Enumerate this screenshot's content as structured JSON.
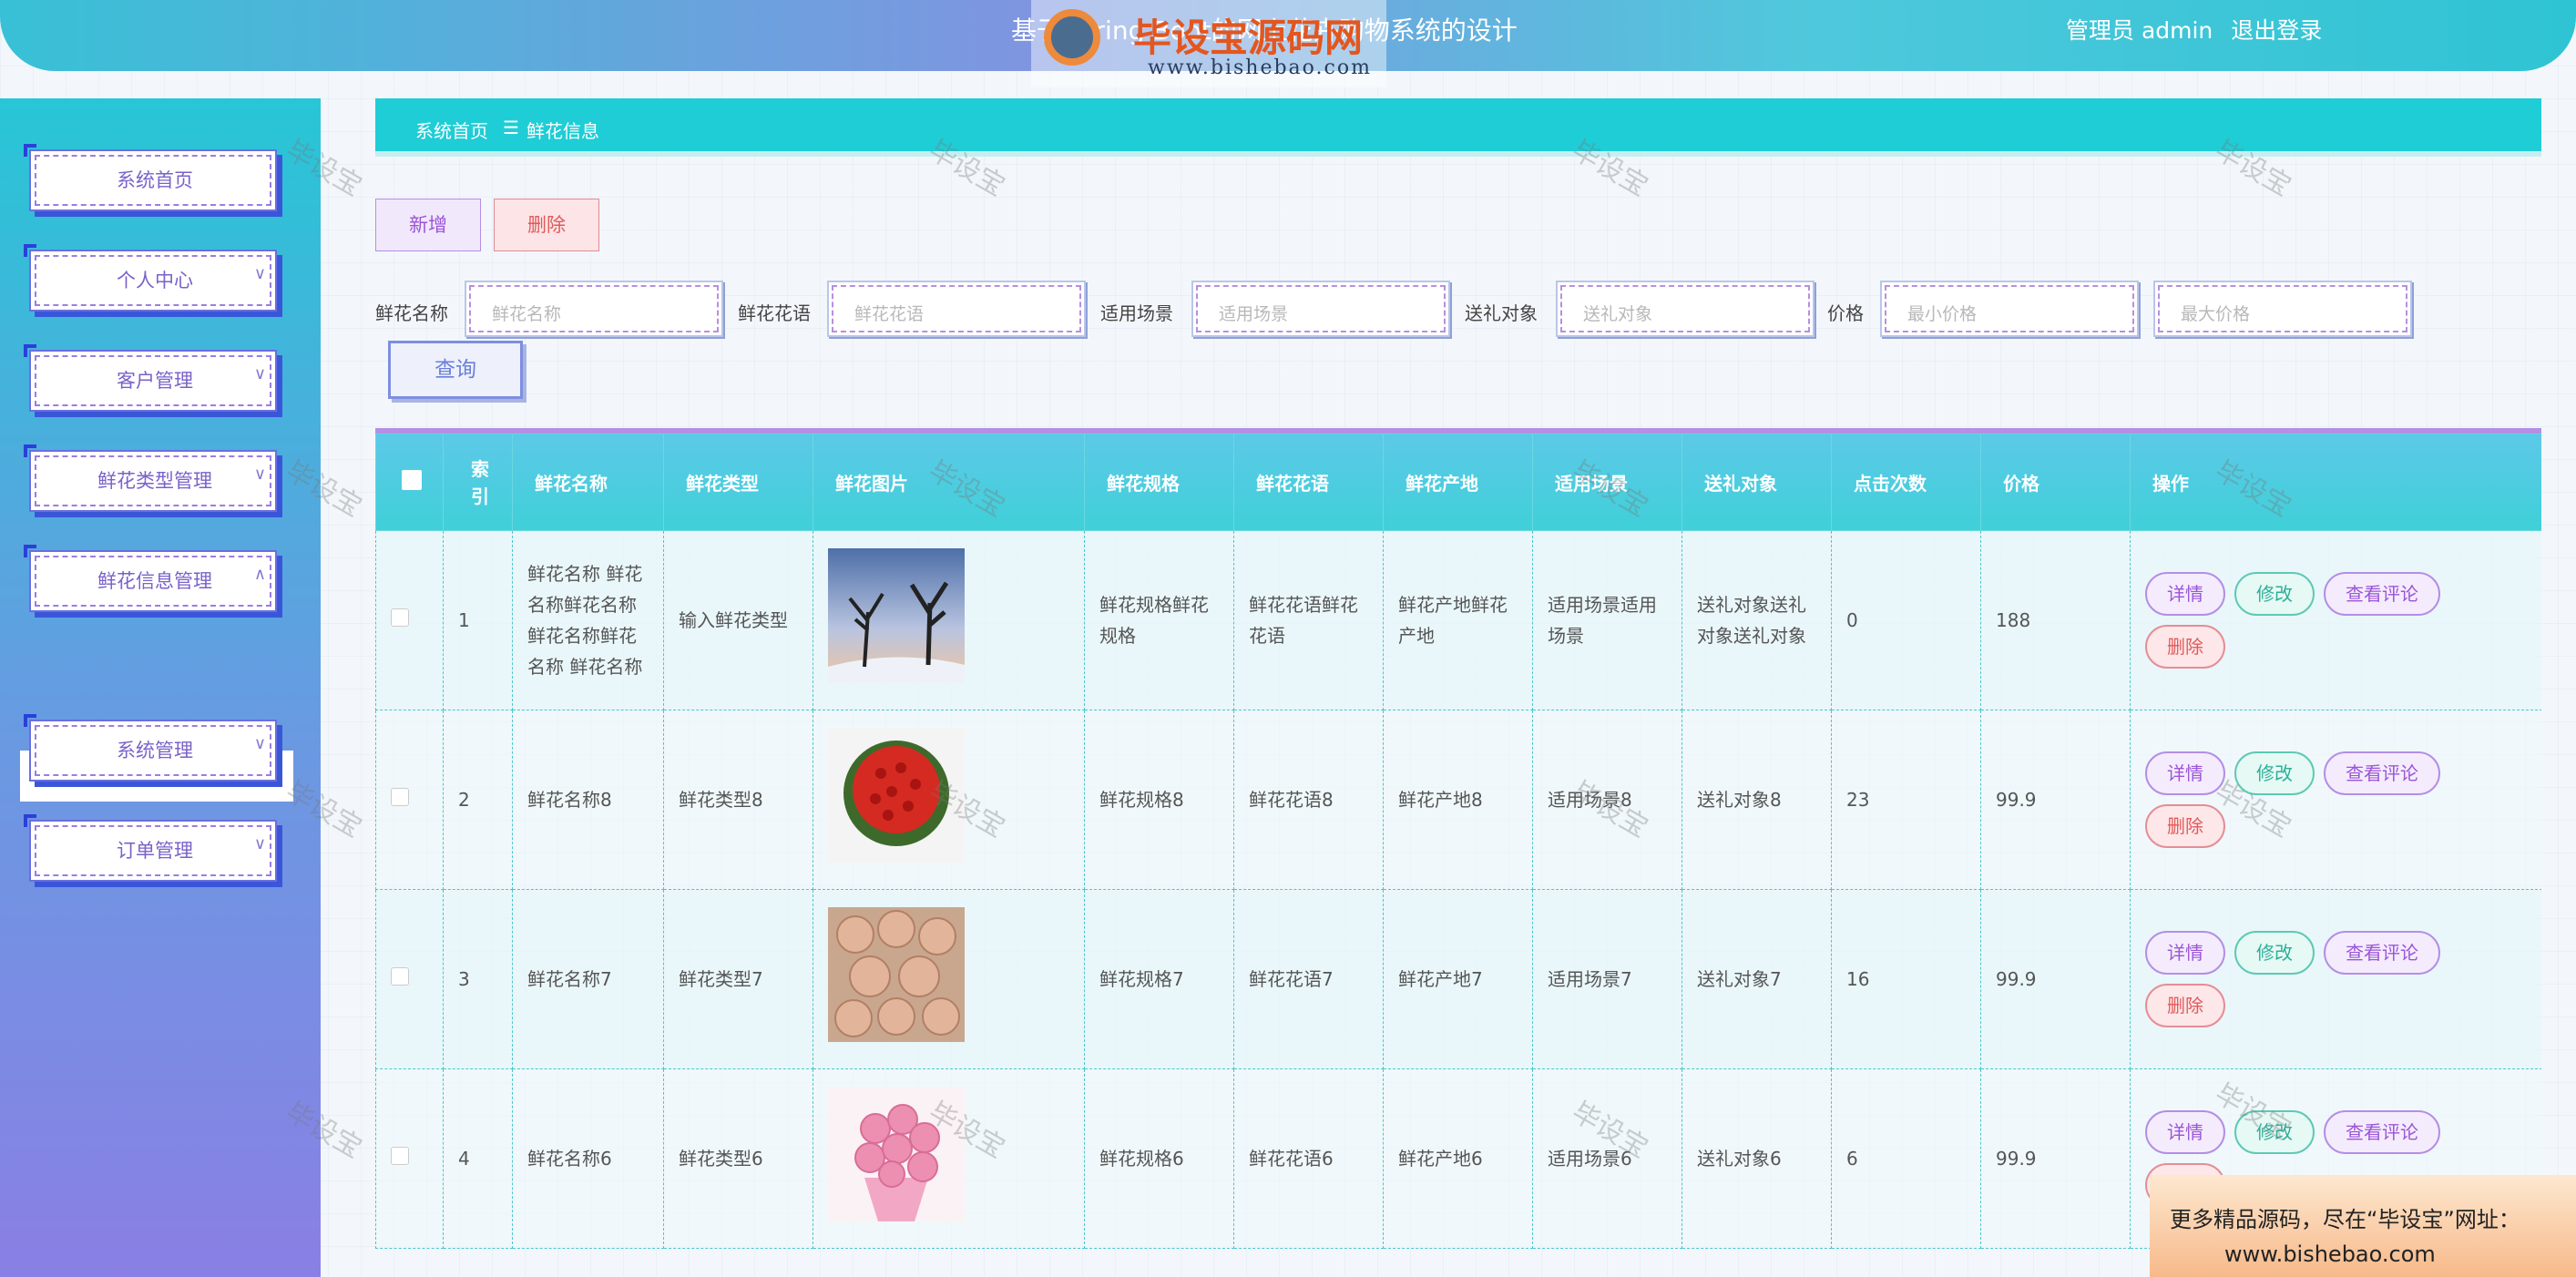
{
  "header": {
    "title": "基于Spring Boot的网上花卉购物系统的设计",
    "user_label": "管理员 admin",
    "logout_label": "退出登录",
    "logo_text": "毕设宝源码网",
    "logo_url": "www.bishebao.com"
  },
  "sidebar": {
    "items": [
      {
        "label": "系统首页"
      },
      {
        "label": "个人中心"
      },
      {
        "label": "客户管理"
      },
      {
        "label": "鲜花类型管理"
      },
      {
        "label": "鲜花信息管理"
      },
      {
        "label": "系统管理"
      },
      {
        "label": "订单管理"
      }
    ],
    "active_sub": "鲜花信息"
  },
  "breadcrumb": {
    "home": "系统首页",
    "separator": "☰",
    "current": "鲜花信息"
  },
  "toolbar": {
    "add_label": "新增",
    "delete_label": "删除"
  },
  "filters": {
    "name": {
      "label": "鲜花名称",
      "placeholder": "鲜花名称"
    },
    "language": {
      "label": "鲜花花语",
      "placeholder": "鲜花花语"
    },
    "scene": {
      "label": "适用场景",
      "placeholder": "适用场景"
    },
    "target": {
      "label": "送礼对象",
      "placeholder": "送礼对象"
    },
    "price": {
      "label": "价格",
      "min_placeholder": "最小价格",
      "max_placeholder": "最大价格"
    },
    "query_label": "查询"
  },
  "table": {
    "headers": [
      "索引",
      "鲜花名称",
      "鲜花类型",
      "鲜花图片",
      "鲜花规格",
      "鲜花花语",
      "鲜花产地",
      "适用场景",
      "送礼对象",
      "点击次数",
      "价格",
      "操作"
    ],
    "index_header": "索\n引",
    "rows": [
      {
        "index": "1",
        "name": "鲜花名称 鲜花名称鲜花名称鲜花名称鲜花名称 鲜花名称",
        "type": "输入鲜花类型",
        "spec": "鲜花规格鲜花规格",
        "language": "鲜花花语鲜花花语",
        "origin": "鲜花产地鲜花产地",
        "scene": "适用场景适用场景",
        "target": "送礼对象送礼对象送礼对象",
        "clicks": "0",
        "price": "188"
      },
      {
        "index": "2",
        "name": "鲜花名称8",
        "type": "鲜花类型8",
        "spec": "鲜花规格8",
        "language": "鲜花花语8",
        "origin": "鲜花产地8",
        "scene": "适用场景8",
        "target": "送礼对象8",
        "clicks": "23",
        "price": "99.9"
      },
      {
        "index": "3",
        "name": "鲜花名称7",
        "type": "鲜花类型7",
        "spec": "鲜花规格7",
        "language": "鲜花花语7",
        "origin": "鲜花产地7",
        "scene": "适用场景7",
        "target": "送礼对象7",
        "clicks": "16",
        "price": "99.9"
      },
      {
        "index": "4",
        "name": "鲜花名称6",
        "type": "鲜花类型6",
        "spec": "鲜花规格6",
        "language": "鲜花花语6",
        "origin": "鲜花产地6",
        "scene": "适用场景6",
        "target": "送礼对象6",
        "clicks": "6",
        "price": "99.9"
      }
    ],
    "actions": {
      "detail": "详情",
      "edit": "修改",
      "comments": "查看评论",
      "delete": "删除"
    }
  },
  "watermark": "毕设宝",
  "banner": {
    "line1": "更多精品源码，尽在“毕设宝”网址：",
    "line2": "www.bishebao.com"
  },
  "colors": {
    "accent": "#1fcdd6",
    "purple": "#9b55d8",
    "danger": "#e05a5a"
  }
}
